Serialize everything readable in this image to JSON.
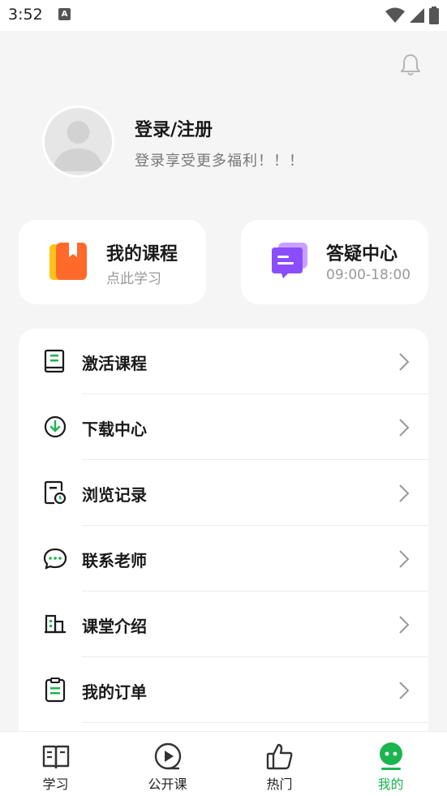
{
  "status_bar": {
    "time": "3:52",
    "badge": "A"
  },
  "profile": {
    "login_title": "登录/注册",
    "login_subtitle": "登录享受更多福利！！！"
  },
  "quick_cards": [
    {
      "title": "我的课程",
      "subtitle": "点此学习",
      "icon": "course-book-icon"
    },
    {
      "title": "答疑中心",
      "subtitle": "09:00-18:00",
      "icon": "chat-bubble-icon"
    }
  ],
  "menu": {
    "items": [
      {
        "label": "激活课程",
        "icon": "book-icon"
      },
      {
        "label": "下载中心",
        "icon": "download-icon"
      },
      {
        "label": "浏览记录",
        "icon": "history-icon"
      },
      {
        "label": "联系老师",
        "icon": "message-icon"
      },
      {
        "label": "课堂介绍",
        "icon": "building-icon"
      },
      {
        "label": "我的订单",
        "icon": "clipboard-icon"
      }
    ]
  },
  "tabbar": {
    "tabs": [
      {
        "label": "学习",
        "icon": "open-book-icon"
      },
      {
        "label": "公开课",
        "icon": "play-icon"
      },
      {
        "label": "热门",
        "icon": "thumbs-up-icon"
      },
      {
        "label": "我的",
        "icon": "smiley-icon",
        "active": true
      }
    ]
  },
  "colors": {
    "accent": "#1bb54f",
    "background": "#f5f5f5"
  }
}
